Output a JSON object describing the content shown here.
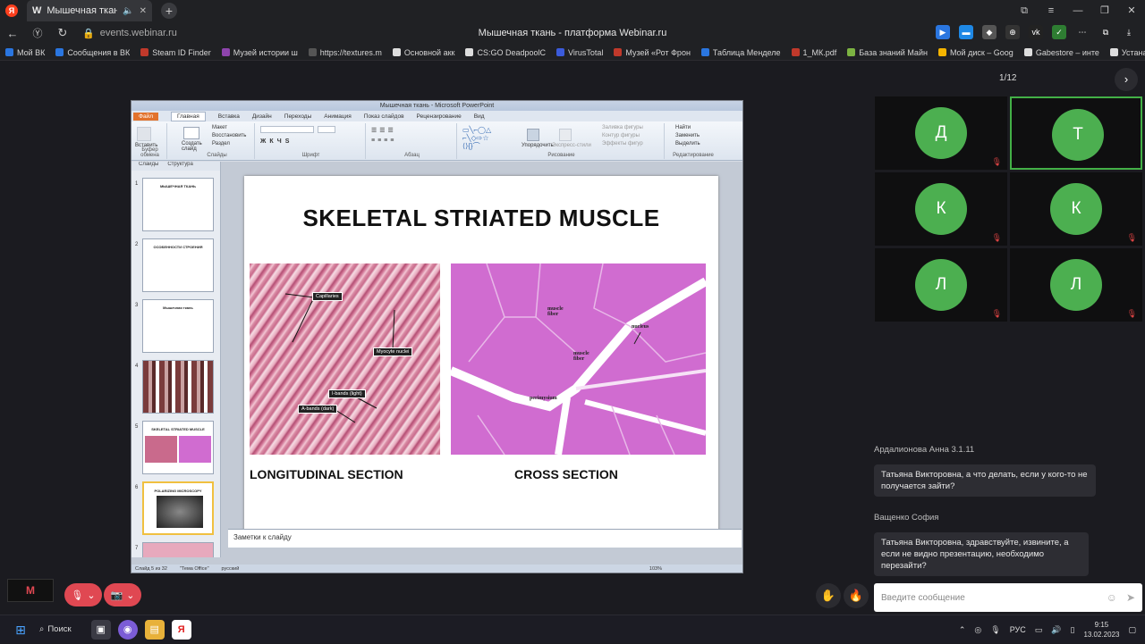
{
  "browser": {
    "tab_title": "Мышечная ткань - п",
    "tab_favicon": "W",
    "new_tab": "+",
    "window_controls": [
      "⧉",
      "≡",
      "—",
      "❐",
      "✕"
    ],
    "url": "events.webinar.ru",
    "page_title": "Мышечная ткань - платформа Webinar.ru",
    "bookmarks": [
      {
        "label": "Мой ВК",
        "color": "#2a76e0"
      },
      {
        "label": "Сообщения в ВК",
        "color": "#2a76e0"
      },
      {
        "label": "Steam ID Finder",
        "color": "#c0392b"
      },
      {
        "label": "Музей истории ш",
        "color": "#8e44ad"
      },
      {
        "label": "https://textures.m",
        "color": "#555555"
      },
      {
        "label": "Основной акк",
        "color": "#dddddd"
      },
      {
        "label": "CS:GO DeadpoolC",
        "color": "#dddddd"
      },
      {
        "label": "VirusTotal",
        "color": "#3b5bdb"
      },
      {
        "label": "Музей «Рот Фрон",
        "color": "#c0392b"
      },
      {
        "label": "Таблица Менделе",
        "color": "#2a76e0"
      },
      {
        "label": "1_МК.pdf",
        "color": "#c0392b"
      },
      {
        "label": "База знаний Майн",
        "color": "#7cb342"
      },
      {
        "label": "Мой диск – Goog",
        "color": "#f4b400"
      },
      {
        "label": "Gabestore – инте",
        "color": "#dddddd"
      },
      {
        "label": "Устанавливаемые",
        "color": "#dddddd"
      }
    ]
  },
  "ppt": {
    "window_title": "Мышечная ткань - Microsoft PowerPoint",
    "menu_tabs": [
      "Файл",
      "Главная",
      "Вставка",
      "Дизайн",
      "Переходы",
      "Анимация",
      "Показ слайдов",
      "Рецензирование",
      "Вид"
    ],
    "ribbon_groups": [
      "Буфер обмена",
      "Слайды",
      "Шрифт",
      "Абзац",
      "Рисование",
      "Редактирование"
    ],
    "ribbon_buttons": {
      "paste": "Вставить",
      "new_slide": "Создать слайд",
      "layout": "Макет",
      "reset": "Восстановить",
      "section": "Раздел",
      "arrange": "Упорядочить",
      "quick_styles": "Экспресс-стили",
      "shape_fill": "Заливка фигуры",
      "shape_outline": "Контур фигуры",
      "shape_effects": "Эффекты фигур",
      "find": "Найти",
      "replace": "Заменить",
      "select": "Выделить"
    },
    "panel_tabs": [
      "Слайды",
      "Структура"
    ],
    "thumbs": [
      {
        "num": "1",
        "title": "МЫШЕЧНАЯ ТКАНЬ"
      },
      {
        "num": "2",
        "title": "ОСОБЕННОСТИ СТРОЕНИЯ"
      },
      {
        "num": "3",
        "title": "Мышечная ткань"
      },
      {
        "num": "4",
        "title": ""
      },
      {
        "num": "5",
        "title": "SKELETAL STRIATED MUSCLE"
      },
      {
        "num": "6",
        "title": "POLARIZING MICROSCOPY"
      },
      {
        "num": "7",
        "title": ""
      }
    ],
    "slide": {
      "title": "SKELETAL STRIATED MUSCLE",
      "left_caption": "LONGITUDINAL SECTION",
      "right_caption": "CROSS SECTION",
      "left_labels": [
        "Capillaries",
        "Myocyte nuclei",
        "I-bands (light)",
        "A-bands (dark)"
      ],
      "right_labels": [
        "muscle fiber",
        "nucleus",
        "muscle fiber",
        "perimysium"
      ]
    },
    "notes_placeholder": "Заметки к слайду",
    "status": {
      "slide": "Слайд 5 из 32",
      "theme": "\"Тема Office\"",
      "lang": "русский",
      "zoom": "103%"
    }
  },
  "webinar": {
    "pager": "1/12",
    "participants": [
      {
        "initial": "Д",
        "muted": true,
        "active": false
      },
      {
        "initial": "Т",
        "muted": false,
        "active": true
      },
      {
        "initial": "К",
        "muted": true,
        "active": false
      },
      {
        "initial": "К",
        "muted": true,
        "active": false
      },
      {
        "initial": "Л",
        "muted": true,
        "active": false
      },
      {
        "initial": "Л",
        "muted": true,
        "active": false
      }
    ],
    "chat": [
      {
        "author": "Ардалионова Анна 3.1.11",
        "text": "Татьяна Викторовна, а что делать, если у кого-то не получается зайти?"
      },
      {
        "author": "Ващенко София",
        "text": "Татьяна Викторовна, здравствуйте, извините, а если не видно презентацию, необходимо перезайти?"
      }
    ],
    "input_placeholder": "Введите сообщение",
    "accent": "#4caf50",
    "mute_color": "#e04852"
  },
  "taskbar": {
    "search": "Поиск",
    "lang": "РУС",
    "time": "9:15",
    "date": "13.02.2023"
  }
}
